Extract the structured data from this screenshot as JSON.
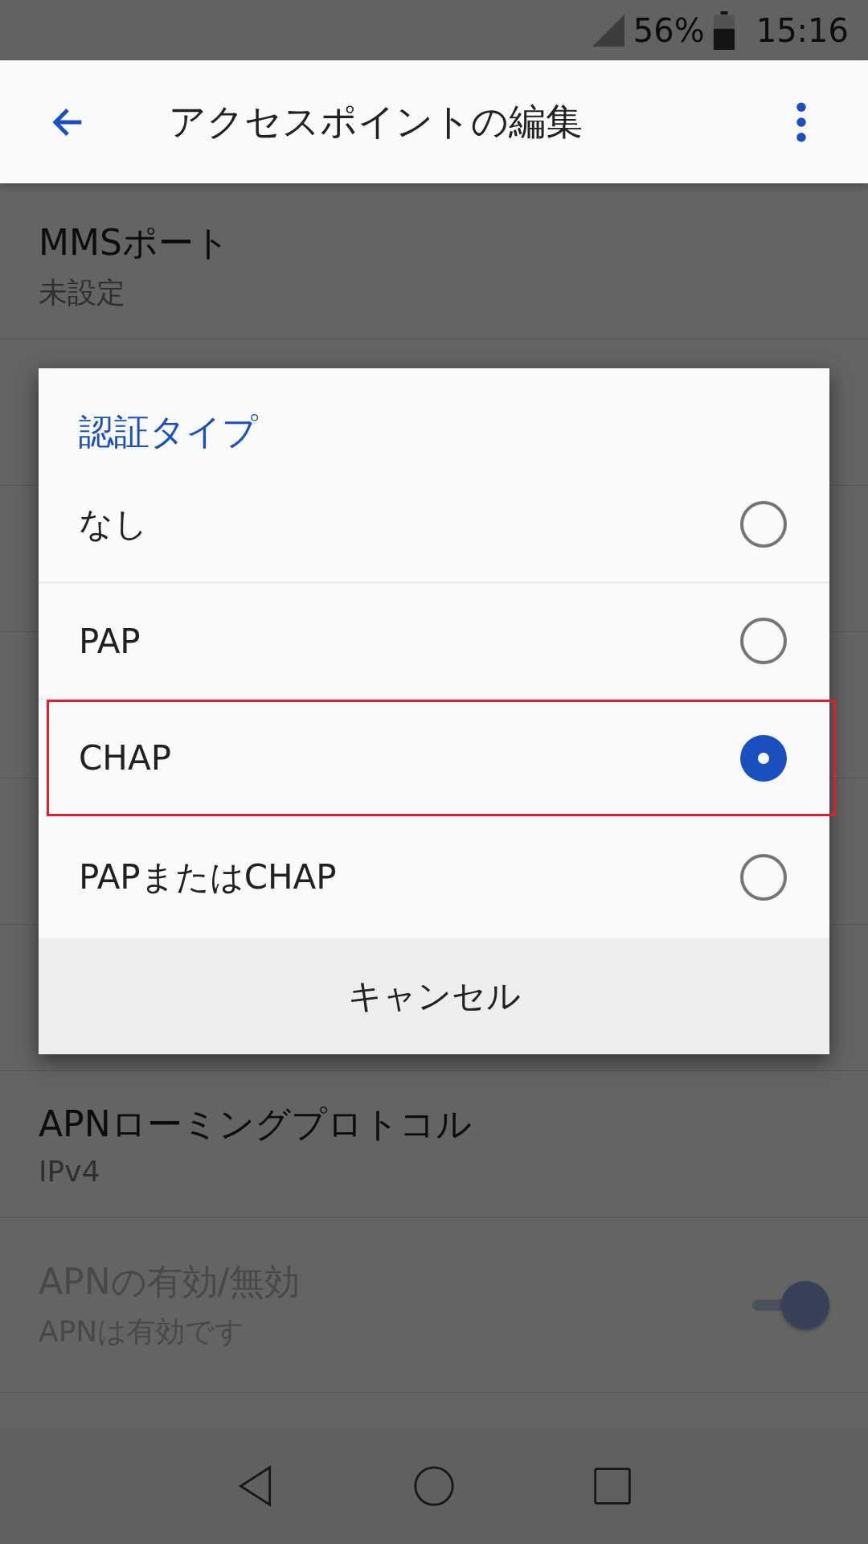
{
  "status_bar": {
    "battery": "56%",
    "time": "15:16"
  },
  "app_bar": {
    "title": "アクセスポイントの編集"
  },
  "settings": [
    {
      "kind": "text",
      "title": "MMSポート",
      "summary": "未設定",
      "disabled": false
    },
    {
      "kind": "text",
      "title": "APNローミングプロトコル",
      "summary": "IPv4",
      "disabled": false
    },
    {
      "kind": "switch",
      "title": "APNの有効/無効",
      "summary": "APNは有効です",
      "disabled": true,
      "on": true
    }
  ],
  "dialog": {
    "title": "認証タイプ",
    "options": [
      {
        "label": "なし",
        "selected": false,
        "highlighted": false
      },
      {
        "label": "PAP",
        "selected": false,
        "highlighted": false
      },
      {
        "label": "CHAP",
        "selected": true,
        "highlighted": true
      },
      {
        "label": "PAPまたはCHAP",
        "selected": false,
        "highlighted": false
      }
    ],
    "cancel": "キャンセル"
  }
}
